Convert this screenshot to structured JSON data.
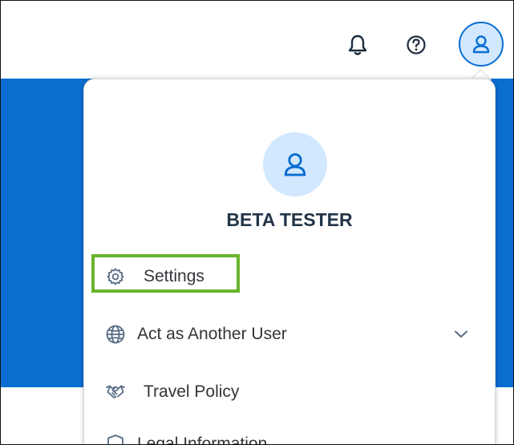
{
  "header": {
    "icons": [
      "bell-icon",
      "help-icon",
      "user-icon"
    ]
  },
  "colors": {
    "brand_blue": "#0a6ed1",
    "avatar_bg": "#d1e8ff",
    "highlight_green": "#6ab42d",
    "text_dark": "#223548"
  },
  "profile_menu": {
    "user_name": "BETA TESTER",
    "items": [
      {
        "label": "Settings",
        "icon": "gear-icon"
      },
      {
        "label": "Act as Another User",
        "icon": "globe-icon",
        "trailing_icon": "chevron-down-icon"
      },
      {
        "label": "Travel Policy",
        "icon": "handshake-icon"
      },
      {
        "label": "Legal Information",
        "icon": "shield-icon"
      }
    ]
  }
}
